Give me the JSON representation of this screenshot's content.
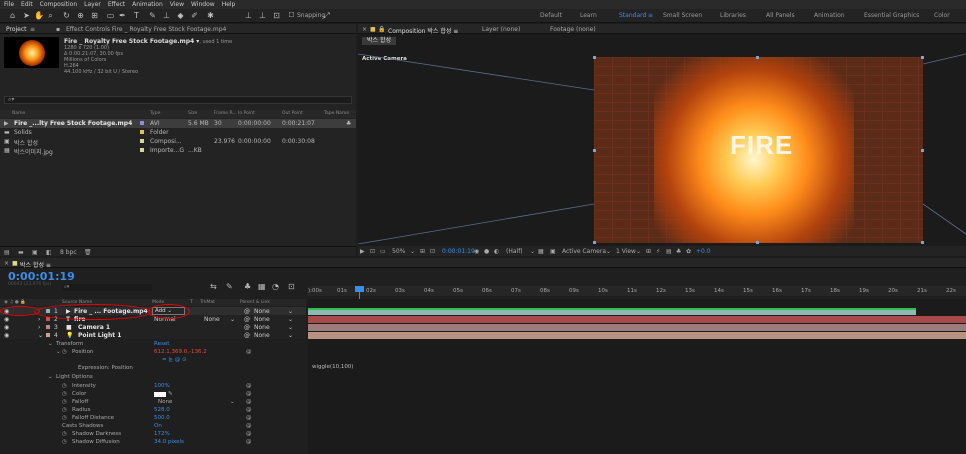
{
  "menu": [
    "File",
    "Edit",
    "Composition",
    "Layer",
    "Effect",
    "Animation",
    "View",
    "Window",
    "Help"
  ],
  "toolbar": {
    "snapping_label": "Snapping"
  },
  "workspaces": [
    "Default",
    "Learn",
    "Standard",
    "Small Screen",
    "Libraries",
    "All Panels",
    "Animation",
    "Essential Graphics",
    "Color"
  ],
  "active_workspace": "Standard",
  "project": {
    "tab_label": "Project",
    "effect_controls": "Effect Controls Fire _ Royalty Free Stock Footage.mp4",
    "file": {
      "name": "Fire _ Royalty Free Stock Footage.mp4 ▾",
      "used": ", used 1 time",
      "line1": "1280 x 720 (1.00)",
      "line2": "Δ 0:00:21:07, 30.00 fps",
      "line3": "Millions of Colors",
      "line4": "H.264",
      "line5": "44.100 kHz / 32 bit U / Stereo"
    },
    "search_placeholder": "⌕▾",
    "columns": {
      "name": "Name",
      "type": "Type",
      "size": "Size",
      "frame_rate": "Frame R...",
      "in_point": "In Point",
      "out_point": "Out Point",
      "tape": "Tape Name"
    },
    "rows": [
      {
        "name": "Fire _...lty Free Stock Footage.mp4",
        "type": "AVI",
        "size": "5.6 MB",
        "fps": "30",
        "in": "0:00:00:00",
        "out": "0:00:21:07",
        "color": "#8a8ee0"
      },
      {
        "name": "Solids",
        "type": "Folder",
        "size": "",
        "fps": "",
        "in": "",
        "out": "",
        "color": "#e0c34a"
      },
      {
        "name": "박스 합성",
        "type": "Composi...",
        "size": "",
        "fps": "23.976",
        "in": "0:00:00:00",
        "out": "0:00:30:08",
        "color": "#d8d890"
      },
      {
        "name": "박스이미지.jpg",
        "type": "Importe...G",
        "size": "...KB",
        "fps": "",
        "in": "",
        "out": "",
        "color": "#d8d890"
      }
    ],
    "bpc": "8 bpc"
  },
  "comp": {
    "tab_label": "Composition 박스 합성 ≡",
    "layer_label": "Layer (none)",
    "footage_label": "Footage (none)",
    "breadcrumb": "박스 합성",
    "active_camera": "Active Camera",
    "fire_text": "FIRE",
    "zoom": "50%",
    "timecode": "0:00:01:19",
    "resolution": "(Half)",
    "view_mode": "Active Camera",
    "views": "1 View",
    "exposure": "+0.0"
  },
  "timeline": {
    "tab_label": "박스 합성 ≡",
    "timecode": "0:00:01:19",
    "fps_label": "00043 (23.976 fps)",
    "search_placeholder": "⌕▾",
    "ruler": [
      "):00s",
      "01s",
      "02s",
      "03s",
      "04s",
      "05s",
      "06s",
      "07s",
      "08s",
      "09s",
      "10s",
      "11s",
      "12s",
      "13s",
      "14s",
      "15s",
      "16s",
      "17s",
      "18s",
      "19s",
      "20s",
      "21s",
      "22s"
    ],
    "headers": {
      "source": "Source Name",
      "mode": "Mode",
      "t": "T",
      "trkmat": "TrkMat",
      "parent": "Parent & Link"
    },
    "layers": [
      {
        "num": "1",
        "name": "Fire _ ... Footage.mp4",
        "mode": "Add",
        "parent": "None",
        "color": "#8fb7b3"
      },
      {
        "num": "2",
        "name": "fire",
        "mode": "Normal",
        "trkmat": "None",
        "parent": "None",
        "color": "#c25454"
      },
      {
        "num": "3",
        "name": "Camera 1",
        "mode": "",
        "parent": "None",
        "color": "#b58c8c"
      },
      {
        "num": "4",
        "name": "Point Light 1",
        "mode": "",
        "parent": "None",
        "color": "#c9a38a"
      }
    ],
    "transform": {
      "label": "Transform",
      "reset": "Reset",
      "position_label": "Position",
      "position_value": "612.1,369.0,-136.2",
      "expression_label": "Expression: Position",
      "expression": "wiggle(10,100)"
    },
    "light_options": {
      "label": "Light Options",
      "props": [
        {
          "name": "Intensity",
          "value": "100%"
        },
        {
          "name": "Color",
          "value": ""
        },
        {
          "name": "Falloff",
          "value": "None"
        },
        {
          "name": "Radius",
          "value": "528.0"
        },
        {
          "name": "Falloff Distance",
          "value": "500.0"
        },
        {
          "name": "Casts Shadows",
          "value": "On"
        },
        {
          "name": "Shadow Darkness",
          "value": "172%"
        },
        {
          "name": "Shadow Diffusion",
          "value": "34.0 pixels"
        }
      ]
    }
  }
}
